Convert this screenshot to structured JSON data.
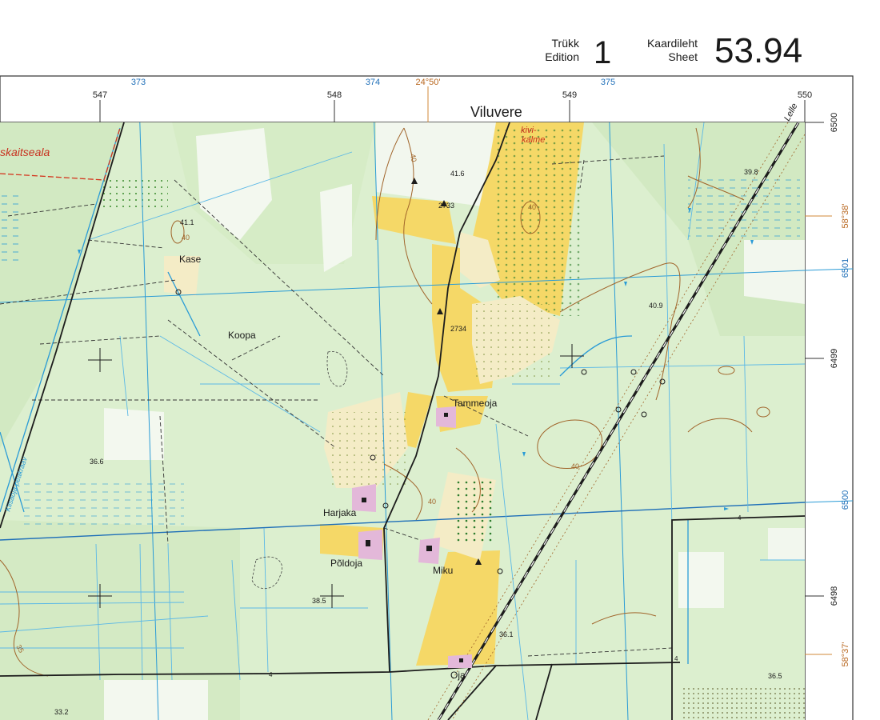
{
  "header": {
    "edition_et": "Trükk",
    "edition_en": "Edition",
    "edition_num": "1",
    "sheet_et": "Kaardileht",
    "sheet_en": "Sheet",
    "sheet_num": "53.94"
  },
  "frame": {
    "top_grid_labels": [
      "373",
      "374",
      "375"
    ],
    "top_long_label": "24°50'",
    "top_km_labels": [
      "547",
      "548",
      "549",
      "550"
    ],
    "right_grid_labels": [
      "6501",
      "6500"
    ],
    "right_km_labels": [
      "6500",
      "6499",
      "6498"
    ],
    "right_lat_labels": [
      "58°38'",
      "58°37'"
    ]
  },
  "places": {
    "viluvere": "Viluvere",
    "kase": "Kase",
    "koopa": "Koopa",
    "tammeoja": "Tammeoja",
    "harjaka": "Harjaka",
    "poldoja": "Põldoja",
    "miku": "Miku",
    "oja": "Oja",
    "lelle": "Lelle",
    "kivikalme_1": "kivi-",
    "kivikalme_2": "kalme",
    "reserve": "skaitseala",
    "ditch": "Kiisaoja peakraav"
  },
  "elevations": {
    "e41_6": "41.6",
    "e39_8": "39.8",
    "e41_1": "41.1",
    "e40_9": "40.9",
    "e36_6": "36.6",
    "e38_5": "38.5",
    "e36_1": "36.1",
    "e36_5": "36.5",
    "e33_2": "33.2"
  },
  "contour_labels": [
    "40",
    "40",
    "40",
    "40",
    "40",
    "35",
    "4",
    "4",
    "4"
  ],
  "benchmarks": {
    "b2733": "2733",
    "b2734": "2734"
  },
  "colors": {
    "meadow": "#dcefcf",
    "forest": "#cfe6c0",
    "field": "#f5d867",
    "settlement": "#f4ecc6",
    "building": "#e3b8d9",
    "contour": "#a0642a",
    "water": "#2a9bd6",
    "grid_blue": "#1f6fb8",
    "road": "#1c1c1c",
    "reserve": "#d4361e"
  }
}
